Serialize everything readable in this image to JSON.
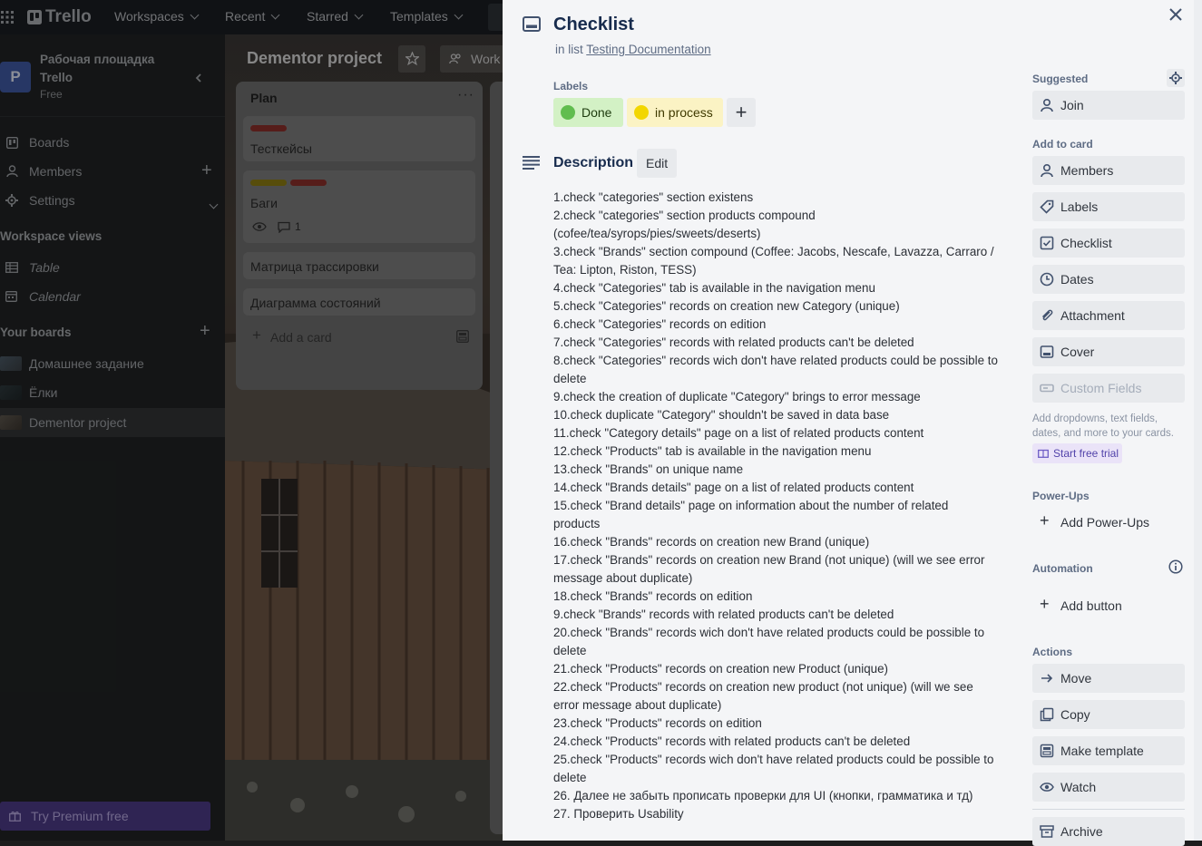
{
  "topnav": {
    "logo": "Trello",
    "workspaces": "Workspaces",
    "recent": "Recent",
    "starred": "Starred",
    "templates": "Templates"
  },
  "sidebar": {
    "avatar_letter": "P",
    "workspace_name_1": "Рабочая площадка",
    "workspace_name_2": "Trello",
    "plan": "Free",
    "nav": {
      "boards": "Boards",
      "members": "Members",
      "settings": "Settings"
    },
    "views_title": "Workspace views",
    "views": {
      "table": "Table",
      "calendar": "Calendar"
    },
    "your_boards_title": "Your boards",
    "boards": [
      "Домашнее задание",
      "Ёлки",
      "Dementor project"
    ],
    "premium": "Try Premium free"
  },
  "board": {
    "title": "Dementor project",
    "workspace_btn": "Work",
    "list": {
      "title": "Plan",
      "cards": [
        {
          "title": "Тесткейсы"
        },
        {
          "title": "Баги",
          "comments": "1"
        },
        {
          "title": "Матрица трассировки"
        },
        {
          "title": "Диаграмма состояний"
        }
      ],
      "add_card": "Add a card"
    }
  },
  "modal": {
    "title": "Checklist",
    "in_list_prefix": "in list ",
    "list_name": "Testing Documentation",
    "labels_title": "Labels",
    "labels": [
      {
        "name": "Done",
        "dot": "#61bd4f",
        "bg": "#d3f1c5"
      },
      {
        "name": "in process",
        "dot": "#f2d600",
        "bg": "#fbf3c4"
      }
    ],
    "add_label": "+",
    "description_title": "Description",
    "edit": "Edit",
    "description_lines": [
      "1.check \"categories\" section existens",
      "2.check \"categories\" section products compound",
      "(cofee/tea/syrops/pies/sweets/deserts)",
      "3.check \"Brands\" section compound (Coffee: Jacobs, Nescafe, Lavazza, Carraro /",
      "Tea: Lipton, Riston, TESS)",
      "4.check \"Categories\" tab is available in the navigation menu",
      "5.check \"Categories\" records on creation new Category (unique)",
      "6.check \"Categories\" records on edition",
      "7.check \"Categories\" records with related products can't be deleted",
      "8.check \"Categories\" records wich don't have related products could be possible to",
      "delete",
      "9.check the creation of duplicate \"Category\" brings to error message",
      "10.check duplicate \"Category\" shouldn't be saved in data base",
      "11.check \"Category details\" page on a list of related products content",
      "12.check \"Products\" tab is available in the navigation menu",
      "13.check \"Brands\" on unique name",
      "14.check \"Brands details\" page on a list of related products content",
      "15.check \"Brand details\" page on information about the number of related",
      "products",
      "16.check \"Brands\" records on creation new Brand (unique)",
      "17.check \"Brands\" records on creation new Brand (not unique) (will we see error",
      "message about duplicate)",
      "18.check \"Brands\" records on edition",
      "9.check \"Brands\" records with related products can't be deleted",
      "20.check \"Brands\" records wich don't have related products could be possible to",
      "delete",
      "21.check \"Products\" records on creation new Product (unique)",
      "22.check \"Products\" records on creation new product (not unique) (will we see",
      "error message about duplicate)",
      "23.check \"Products\" records on edition",
      "24.check \"Products\" records with related products can't be deleted",
      "25.check \"Products\" records wich don't have related products could be possible to",
      "delete",
      "26. Далее не забыть прописать проверки для UI (кнопки, грамматика и тд)",
      "27. Проверить Usability"
    ],
    "side": {
      "suggested": "Suggested",
      "join": "Join",
      "add_to_card": "Add to card",
      "members": "Members",
      "labels": "Labels",
      "checklist": "Checklist",
      "dates": "Dates",
      "attachment": "Attachment",
      "cover": "Cover",
      "custom_fields": "Custom Fields",
      "cf_note_1": "Add dropdowns, text fields,",
      "cf_note_2": "dates, and more to your cards.",
      "trial": "Start free trial",
      "powerups": "Power-Ups",
      "add_powerups": "Add Power-Ups",
      "automation": "Automation",
      "add_button": "Add button",
      "actions": "Actions",
      "move": "Move",
      "copy": "Copy",
      "make_template": "Make template",
      "watch": "Watch",
      "archive": "Archive"
    }
  }
}
